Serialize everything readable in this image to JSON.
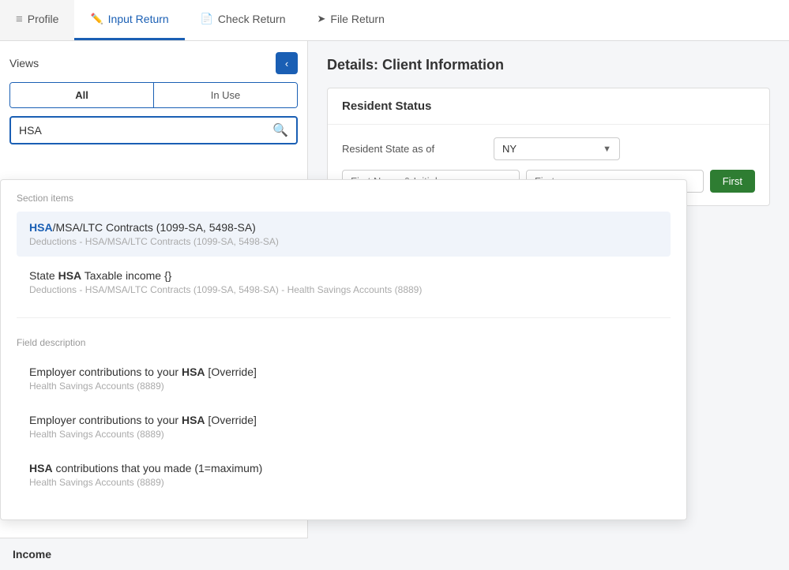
{
  "nav": {
    "tabs": [
      {
        "id": "profile",
        "label": "Profile",
        "icon": "list-icon",
        "active": false
      },
      {
        "id": "input-return",
        "label": "Input Return",
        "icon": "pencil-icon",
        "active": true
      },
      {
        "id": "check-return",
        "label": "Check Return",
        "icon": "doc-icon",
        "active": false
      },
      {
        "id": "file-return",
        "label": "File Return",
        "icon": "send-icon",
        "active": false
      }
    ]
  },
  "left_panel": {
    "views_label": "Views",
    "collapse_icon": "‹",
    "toggle": {
      "all_label": "All",
      "in_use_label": "In Use"
    },
    "search": {
      "value": "HSA",
      "placeholder": ""
    }
  },
  "dropdown": {
    "section_items_label": "Section items",
    "field_description_label": "Field description",
    "items_section": [
      {
        "id": "item1",
        "title_parts": [
          {
            "text": "HSA",
            "bold": true,
            "blue": true
          },
          {
            "text": "/MSA/LTC Contracts (1099-SA, 5498-SA)",
            "bold": false
          }
        ],
        "subtitle": "Deductions - HSA/MSA/LTC Contracts (1099-SA, 5498-SA)",
        "highlighted": true
      },
      {
        "id": "item2",
        "title_parts": [
          {
            "text": "State ",
            "bold": false
          },
          {
            "text": "HSA",
            "bold": true,
            "blue": false
          },
          {
            "text": " Taxable income {}",
            "bold": false
          }
        ],
        "subtitle": "Deductions - HSA/MSA/LTC Contracts (1099-SA, 5498-SA) - Health Savings Accounts (8889)"
      }
    ],
    "field_items": [
      {
        "id": "field1",
        "title_parts": [
          {
            "text": "Employer contributions to your ",
            "bold": false
          },
          {
            "text": "HSA",
            "bold": true
          },
          {
            "text": " [Override]",
            "bold": false
          }
        ],
        "subtitle": "Health Savings Accounts (8889)"
      },
      {
        "id": "field2",
        "title_parts": [
          {
            "text": "Employer contributions to your ",
            "bold": false
          },
          {
            "text": "HSA",
            "bold": true
          },
          {
            "text": " [Override]",
            "bold": false
          }
        ],
        "subtitle": "Health Savings Accounts (8889)"
      },
      {
        "id": "field3",
        "title_parts": [
          {
            "text": "HSA",
            "bold": true
          },
          {
            "text": " contributions that you made (1=maximum)",
            "bold": false
          }
        ],
        "subtitle": "Health Savings Accounts (8889)"
      }
    ]
  },
  "right_panel": {
    "title": "Details: Client Information",
    "section": {
      "header": "Resident Status",
      "field_label": "Resident State as of",
      "field_value": "NY",
      "first_name_placeholder": "First Name & Initial",
      "last_name_placeholder": "First",
      "apply_label": "First"
    }
  },
  "income_label": "Income"
}
